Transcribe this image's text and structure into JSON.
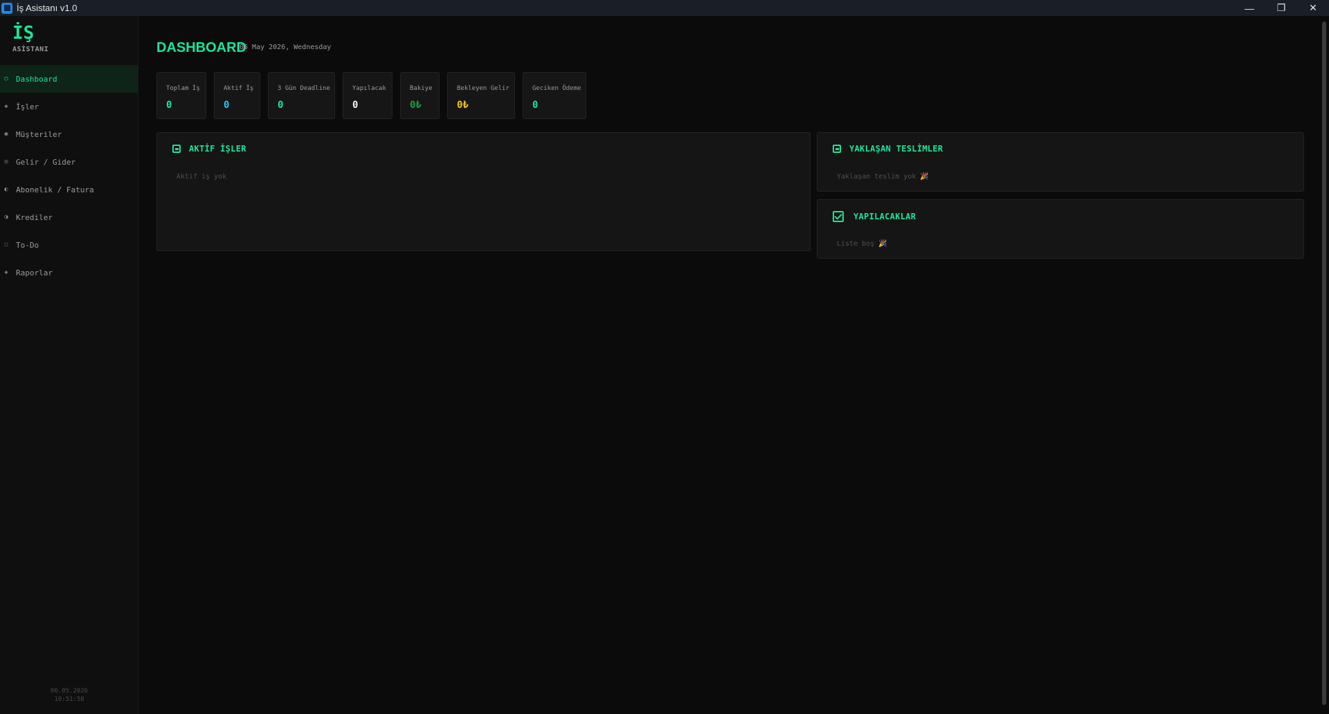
{
  "window": {
    "title": "İş Asistanı  v1.0",
    "controls": {
      "minimize": "—",
      "restore": "❐",
      "close": "✕"
    }
  },
  "sidebar": {
    "logo_main": "İŞ",
    "logo_sub": "ASİSTANI",
    "items": [
      {
        "label": "Dashboard",
        "icon": "○",
        "active": true
      },
      {
        "label": "İşler",
        "icon": "◈"
      },
      {
        "label": "Müşteriler",
        "icon": "◉"
      },
      {
        "label": "Gelir / Gider",
        "icon": "◎"
      },
      {
        "label": "Abonelik / Fatura",
        "icon": "◐"
      },
      {
        "label": "Krediler",
        "icon": "◑"
      },
      {
        "label": "To-Do",
        "icon": "☐"
      },
      {
        "label": "Raporlar",
        "icon": "◈"
      }
    ],
    "clock_date": "06.05.2026",
    "clock_time": "10:51:58"
  },
  "main": {
    "title": "DASHBOARD",
    "date": "06 May 2026, Wednesday",
    "stats": [
      {
        "label": "Toplam İş",
        "value": "0",
        "color": "#19e59a"
      },
      {
        "label": "Aktif İş",
        "value": "0",
        "color": "#22c7f0"
      },
      {
        "label": "3 Gün Deadline",
        "value": "0",
        "color": "#19e59a"
      },
      {
        "label": "Yapılacak",
        "value": "0",
        "color": "#f2f2f2"
      },
      {
        "label": "Bakiye",
        "value": "0₺",
        "color": "#1f9d3c"
      },
      {
        "label": "Bekleyen Gelir",
        "value": "0₺",
        "color": "#f5c518"
      },
      {
        "label": "Geciken Ödeme",
        "value": "0",
        "color": "#19e59a"
      }
    ],
    "panels": {
      "active_jobs": {
        "title": "AKTİF İŞLER",
        "empty": "Aktif iş yok"
      },
      "upcoming": {
        "title": "YAKLAŞAN TESLİMLER",
        "empty": "Yaklaşan teslim yok 🎉"
      },
      "todo": {
        "title": "YAPILACAKLAR",
        "empty": "Liste boş 🎉"
      }
    }
  },
  "colors": {
    "accent": "#19e59a",
    "background": "#0b0b0b",
    "panel": "#151515"
  }
}
